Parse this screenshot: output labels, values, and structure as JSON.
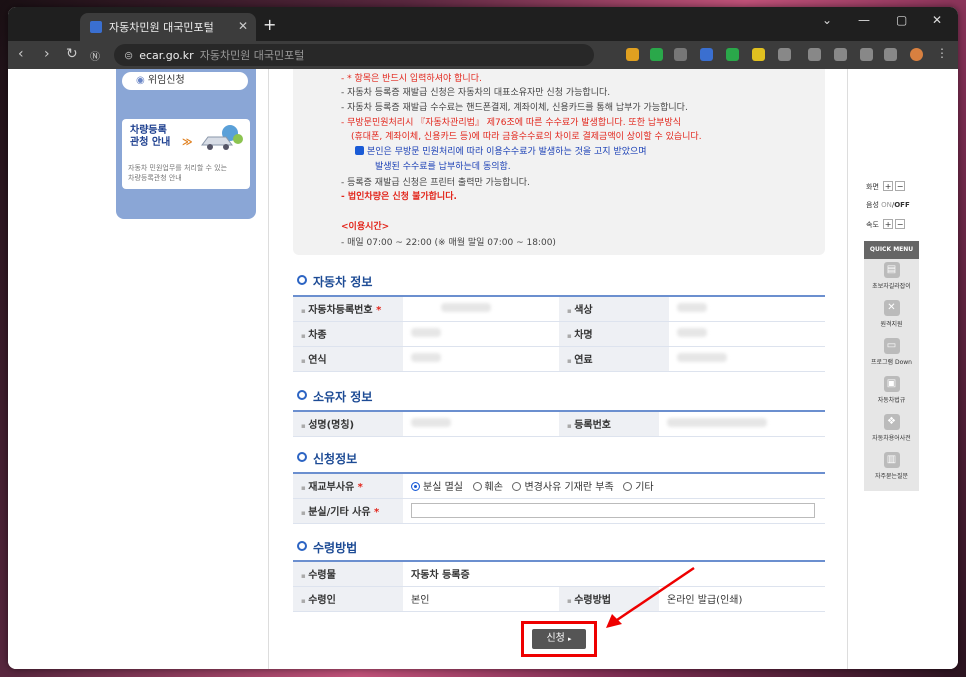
{
  "browser": {
    "tab_title": "자동차민원 대국민포털",
    "tab_close": "✕",
    "new_tab": "+",
    "url": "ecar.go.kr",
    "url_title": "자동차민원 대국민포털"
  },
  "sidebar": {
    "proxy_apply": "위임신청",
    "car_reg_title": "차량등록\n관청 안내",
    "car_reg_arrow": "≫",
    "car_reg_desc": "자동차 민원업무를 처리할 수 있는\n차량등록관청 안내"
  },
  "notice": {
    "line0": "- * 항목은 반드시 입력하셔야 합니다.",
    "line1": "- 자동차 등록증 재발급 신청은 자동차의 대표소유자만 신청 가능합니다.",
    "line2": "- 자동차 등록증 재발급 수수료는 핸드폰결제, 계좌이체, 신용카드를 통해 납부가 가능합니다.",
    "line3": "- 무방문민원처리시 『자동차관리법』 제76조에 따른 수수료가 발생합니다. 또한 납부방식",
    "line4": "(휴대폰, 계좌이체, 신용카드 등)에 따라 금융수수료의 차이로 결제금액이 상이할 수 있습니다.",
    "line5": "본인은 무방문 민원처리에 따라 이용수수료가 발생하는 것을 고지 받았으며",
    "line6": "발생된 수수료를 납부하는데 동의함.",
    "line7": "- 등록증 재발급 신청은 프린터 출력만 가능합니다.",
    "line8": "- 법인차량은 신청 불가합니다.",
    "hours_title": "<이용시간>",
    "hours": "- 매일 07:00 ~ 22:00 (※ 매월 말일 07:00 ~ 18:00)"
  },
  "vehicle": {
    "title": "자동차 정보",
    "reg_no": "자동차등록번호",
    "color": "색상",
    "type": "차종",
    "name": "차명",
    "year": "연식",
    "fuel": "연료"
  },
  "owner": {
    "title": "소유자 정보",
    "name": "성명(명칭)",
    "reg_no": "등록번호"
  },
  "apply": {
    "title": "신청정보",
    "reason_label": "재교부사유",
    "reasons": [
      "분실 멸실",
      "훼손",
      "변경사유 기재란 부족",
      "기타"
    ],
    "other_label": "분실/기타 사유"
  },
  "receive": {
    "title": "수령방법",
    "item_label": "수령물",
    "item_value": "자동차 등록증",
    "person_label": "수령인",
    "person_value": "본인",
    "method_label": "수령방법",
    "method_value": "온라인 발급(인쇄)"
  },
  "apply_button": "신청",
  "required_mark": "*",
  "controls": {
    "screen": "화면",
    "sound": "음성",
    "sound_on": "ON",
    "sound_off": "OFF",
    "speed": "속도",
    "plus": "+",
    "minus": "−"
  },
  "quick_menu": {
    "title": "QUICK MENU",
    "items": [
      "초보자길라잡이",
      "원격지원",
      "프로그램 Down",
      "자동차법규",
      "자동차용어사전",
      "자주묻는질문"
    ]
  },
  "colors": {
    "accent": "#1d4b95",
    "alert": "#e2261c",
    "highlight": "#ee0000"
  }
}
